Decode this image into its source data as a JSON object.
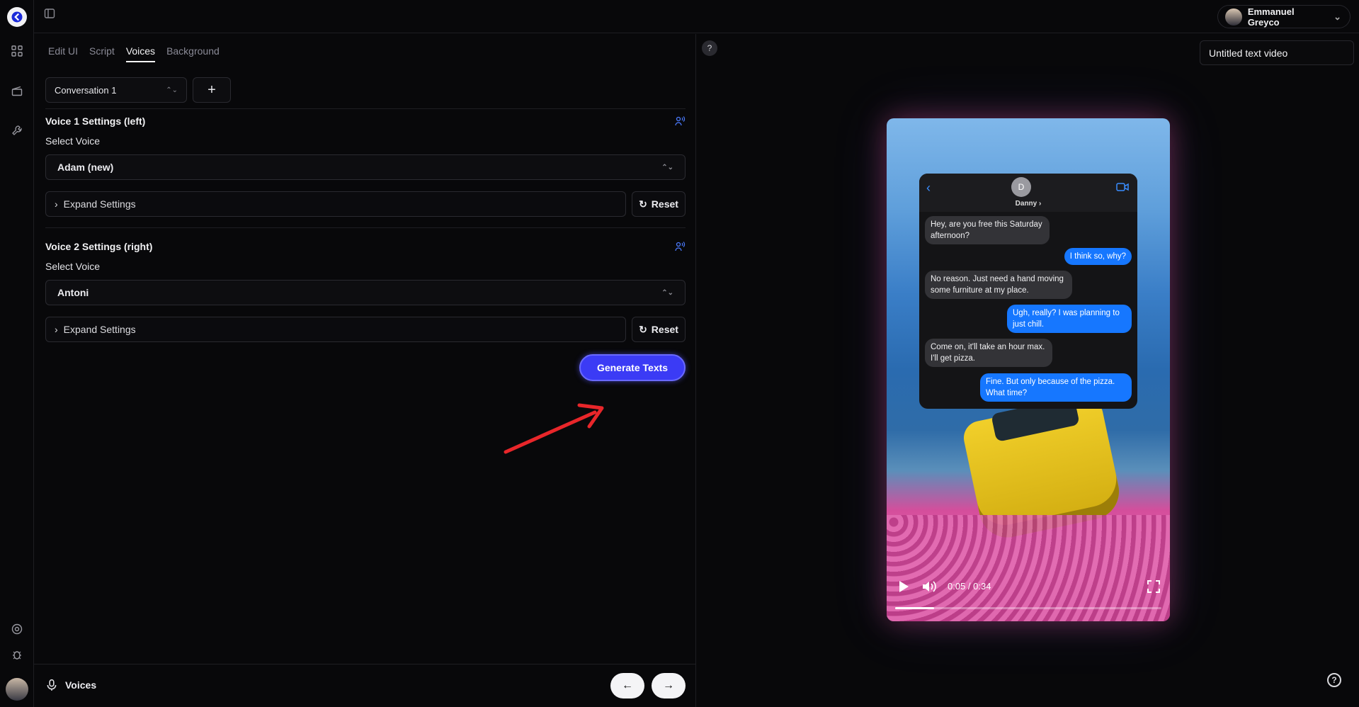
{
  "user": {
    "name": "Emmanuel Greyco"
  },
  "tabs": [
    {
      "label": "Edit UI"
    },
    {
      "label": "Script"
    },
    {
      "label": "Voices"
    },
    {
      "label": "Background"
    }
  ],
  "conversation": {
    "selected": "Conversation 1",
    "add_label": "+"
  },
  "voice1": {
    "title": "Voice 1 Settings (left)",
    "select_label": "Select Voice",
    "voice": "Adam (new)",
    "expand_label": "Expand Settings",
    "reset_label": "Reset"
  },
  "voice2": {
    "title": "Voice 2 Settings (right)",
    "select_label": "Select Voice",
    "voice": "Antoni",
    "expand_label": "Expand Settings",
    "reset_label": "Reset"
  },
  "generate_label": "Generate Texts",
  "footer": {
    "label": "Voices"
  },
  "video_title": "Untitled text video",
  "help_label": "?",
  "chat": {
    "avatar_letter": "D",
    "contact": "Danny ›",
    "messages": [
      {
        "side": "in",
        "text": "Hey, are you free this Saturday afternoon?"
      },
      {
        "side": "out",
        "text": "I think so, why?"
      },
      {
        "side": "in",
        "text": "No reason. Just need a hand moving some furniture at my place."
      },
      {
        "side": "out",
        "text": "Ugh, really? I was planning to just chill."
      },
      {
        "side": "in",
        "text": "Come on, it'll take an hour max. I'll get pizza."
      },
      {
        "side": "out",
        "text": "Fine. But only because of the pizza. What time?"
      }
    ]
  },
  "player": {
    "time": "0:05 / 0:34",
    "progress": 0.147
  },
  "colors": {
    "accent": "#3b3bf5",
    "bubble_out": "#1677ff",
    "bubble_in": "#333337"
  }
}
